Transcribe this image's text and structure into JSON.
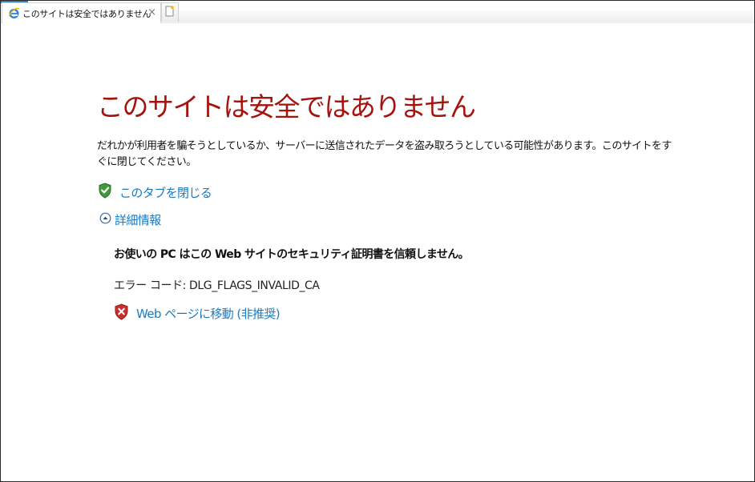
{
  "tab": {
    "title": "このサイトは安全ではありません",
    "close_symbol": "×",
    "favicon": "ie-icon",
    "new_tab_icon": "new-tab-icon"
  },
  "page": {
    "heading": "このサイトは安全ではありません",
    "description": "だれかが利用者を騙そうとしているか、サーバーに送信されたデータを盗み取ろうとしている可能性があります。このサイトをすぐに閉じてください。",
    "close_tab_label": "このタブを閉じる",
    "details_label": "詳細情報",
    "details": {
      "message": "お使いの PC はこの Web サイトのセキュリティ証明書を信頼しません。",
      "error_code": "エラー コード:  DLG_FLAGS_INVALID_CA",
      "go_to_page_label": "Web ページに移動 (非推奨)"
    }
  },
  "colors": {
    "heading": "#a4130e",
    "link": "#1b7bbf",
    "shield_green": "#3f9b3a",
    "shield_red": "#c9302c"
  }
}
